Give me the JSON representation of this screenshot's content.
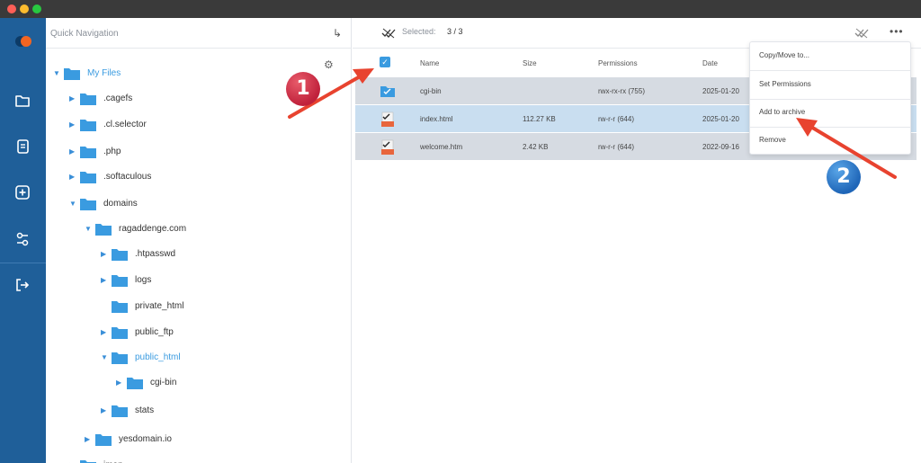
{
  "sidebar": {
    "title": "Quick Navigation",
    "collapse_icon": "collapse-arrow-icon",
    "items": [
      {
        "label": "My Files",
        "expanded": true,
        "highlight": true
      },
      {
        "label": ".cagefs"
      },
      {
        "label": ".cl.selector"
      },
      {
        "label": ".php"
      },
      {
        "label": ".softaculous"
      },
      {
        "label": "domains",
        "expanded": true
      },
      {
        "label": "ragaddenge.com",
        "expanded": true
      },
      {
        "label": ".htpasswd"
      },
      {
        "label": "logs"
      },
      {
        "label": "private_html"
      },
      {
        "label": "public_ftp"
      },
      {
        "label": "public_html",
        "expanded": true,
        "highlight": true
      },
      {
        "label": "cgi-bin"
      },
      {
        "label": "stats"
      },
      {
        "label": "yesdomain.io"
      },
      {
        "label": "imap"
      }
    ]
  },
  "toolbar": {
    "selected_label": "Selected:",
    "selected_count": "3 / 3"
  },
  "table": {
    "columns": [
      "Name",
      "Size",
      "Permissions",
      "Date"
    ],
    "rows": [
      {
        "name": "cgi-bin",
        "size": "",
        "permissions": "rwx-rx-rx (755)",
        "date": "2025-01-20",
        "type": "folder"
      },
      {
        "name": "index.html",
        "size": "112.27 KB",
        "permissions": "rw-r-r (644)",
        "date": "2025-01-20",
        "type": "html"
      },
      {
        "name": "welcome.htm",
        "size": "2.42 KB",
        "permissions": "rw-r-r (644)",
        "date": "2022-09-16",
        "type": "html"
      }
    ]
  },
  "context_menu": {
    "items": [
      "Copy/Move to...",
      "Set Permissions",
      "Add to archive",
      "Remove"
    ]
  },
  "annotations": {
    "badge_1": "1",
    "badge_2": "2"
  },
  "colors": {
    "rail": "#1f5f99",
    "accent": "#3a9be0",
    "arrow": "#e8432f"
  }
}
